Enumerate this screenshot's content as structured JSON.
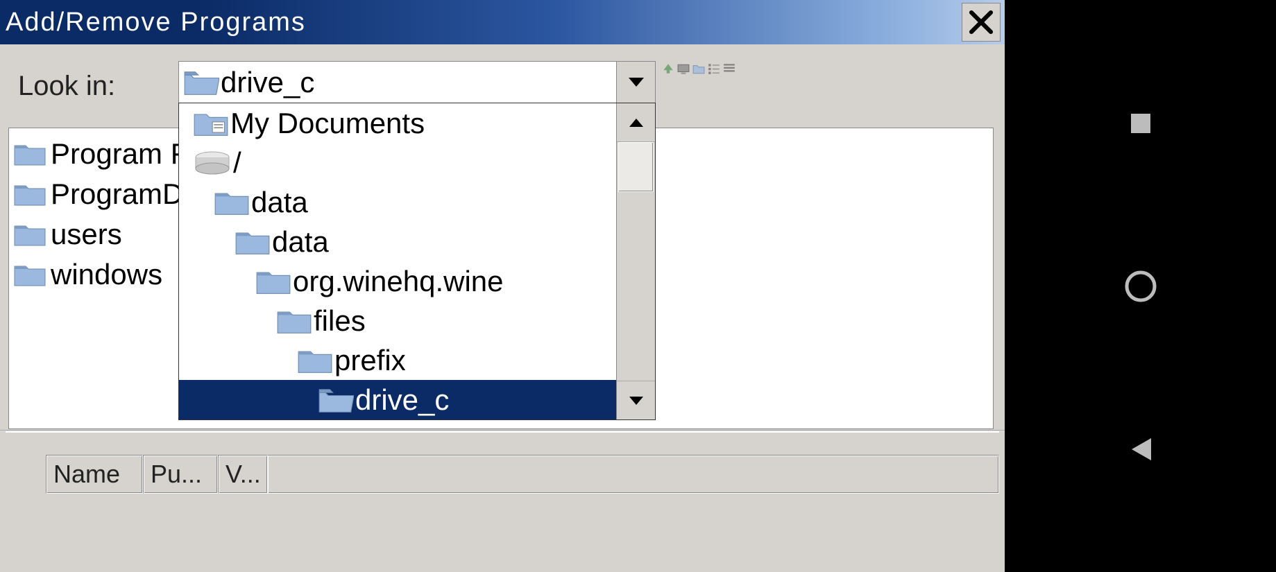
{
  "window": {
    "title": "Add/Remove Programs"
  },
  "lookin": {
    "label": "Look in:",
    "current": "drive_c"
  },
  "file_list": [
    "Program Files",
    "ProgramData",
    "users",
    "windows"
  ],
  "dropdown_tree": [
    {
      "label": "My Documents",
      "indent": 0,
      "icon": "docs",
      "selected": false
    },
    {
      "label": "/",
      "indent": 0,
      "icon": "drive",
      "selected": false
    },
    {
      "label": "data",
      "indent": 1,
      "icon": "folder",
      "selected": false
    },
    {
      "label": "data",
      "indent": 2,
      "icon": "folder",
      "selected": false
    },
    {
      "label": "org.winehq.wine",
      "indent": 3,
      "icon": "folder",
      "selected": false
    },
    {
      "label": "files",
      "indent": 4,
      "icon": "folder",
      "selected": false
    },
    {
      "label": "prefix",
      "indent": 5,
      "icon": "folder",
      "selected": false
    },
    {
      "label": "drive_c",
      "indent": 6,
      "icon": "folder-open",
      "selected": true
    }
  ],
  "table_headers": [
    "Name",
    "Pu...",
    "V..."
  ],
  "toolbar_icons": [
    "up-icon",
    "desktop-icon",
    "new-folder-icon",
    "list-view-icon",
    "detail-view-icon"
  ]
}
